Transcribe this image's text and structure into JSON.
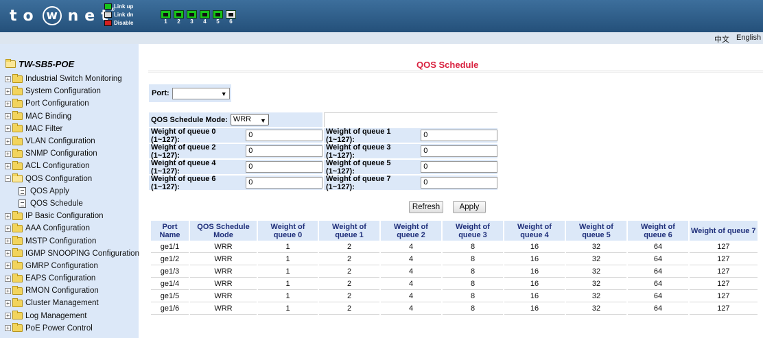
{
  "header": {
    "logo_text": "to",
    "logo_circle": "w",
    "logo_rest": "net",
    "logo_reg": "®",
    "legend": [
      {
        "label": "Link up",
        "color": "#18c418"
      },
      {
        "label": "Link dn",
        "color": "#d8d8d8"
      },
      {
        "label": "Disable",
        "color": "#d42020"
      }
    ],
    "ports": [
      {
        "num": "1",
        "state": "up"
      },
      {
        "num": "2",
        "state": "up"
      },
      {
        "num": "3",
        "state": "up"
      },
      {
        "num": "4",
        "state": "up"
      },
      {
        "num": "5",
        "state": "up"
      },
      {
        "num": "6",
        "state": "dn"
      }
    ]
  },
  "langbar": {
    "chinese": "中文",
    "english": "English"
  },
  "sidebar": {
    "root": "TW-SB5-POE",
    "items": [
      {
        "label": "Industrial Switch Monitoring"
      },
      {
        "label": "System Configuration"
      },
      {
        "label": "Port Configuration"
      },
      {
        "label": "MAC Binding"
      },
      {
        "label": "MAC Filter"
      },
      {
        "label": "VLAN Configuration"
      },
      {
        "label": "SNMP Configuration"
      },
      {
        "label": "ACL Configuration"
      },
      {
        "label": "QOS Configuration"
      },
      {
        "label": "QOS Apply"
      },
      {
        "label": "QOS Schedule"
      },
      {
        "label": "IP Basic Configuration"
      },
      {
        "label": "AAA Configuration"
      },
      {
        "label": "MSTP Configuration"
      },
      {
        "label": "IGMP SNOOPING Configuration"
      },
      {
        "label": "GMRP Configuration"
      },
      {
        "label": "EAPS Configuration"
      },
      {
        "label": "RMON Configuration"
      },
      {
        "label": "Cluster Management"
      },
      {
        "label": "Log Management"
      },
      {
        "label": "PoE Power Control"
      }
    ]
  },
  "main": {
    "title": "QOS Schedule",
    "port_label": "Port:",
    "port_value": "",
    "mode_label": "QOS Schedule Mode:",
    "mode_value": "WRR",
    "weights": [
      {
        "label": "Weight of queue 0 (1~127):",
        "value": "0"
      },
      {
        "label": "Weight of queue 1 (1~127):",
        "value": "0"
      },
      {
        "label": "Weight of queue 2 (1~127):",
        "value": "0"
      },
      {
        "label": "Weight of queue 3 (1~127):",
        "value": "0"
      },
      {
        "label": "Weight of queue 4 (1~127):",
        "value": "0"
      },
      {
        "label": "Weight of queue 5 (1~127):",
        "value": "0"
      },
      {
        "label": "Weight of queue 6 (1~127):",
        "value": "0"
      },
      {
        "label": "Weight of queue 7 (1~127):",
        "value": "0"
      }
    ],
    "refresh_label": "Refresh",
    "apply_label": "Apply"
  },
  "table": {
    "headers": [
      "Port Name",
      "QOS Schedule Mode",
      "Weight of queue 0",
      "Weight of queue 1",
      "Weight of queue 2",
      "Weight of queue 3",
      "Weight of queue 4",
      "Weight of queue 5",
      "Weight of queue 6",
      "Weight of queue 7"
    ],
    "rows": [
      [
        "ge1/1",
        "WRR",
        "1",
        "2",
        "4",
        "8",
        "16",
        "32",
        "64",
        "127"
      ],
      [
        "ge1/2",
        "WRR",
        "1",
        "2",
        "4",
        "8",
        "16",
        "32",
        "64",
        "127"
      ],
      [
        "ge1/3",
        "WRR",
        "1",
        "2",
        "4",
        "8",
        "16",
        "32",
        "64",
        "127"
      ],
      [
        "ge1/4",
        "WRR",
        "1",
        "2",
        "4",
        "8",
        "16",
        "32",
        "64",
        "127"
      ],
      [
        "ge1/5",
        "WRR",
        "1",
        "2",
        "4",
        "8",
        "16",
        "32",
        "64",
        "127"
      ],
      [
        "ge1/6",
        "WRR",
        "1",
        "2",
        "4",
        "8",
        "16",
        "32",
        "64",
        "127"
      ]
    ]
  }
}
